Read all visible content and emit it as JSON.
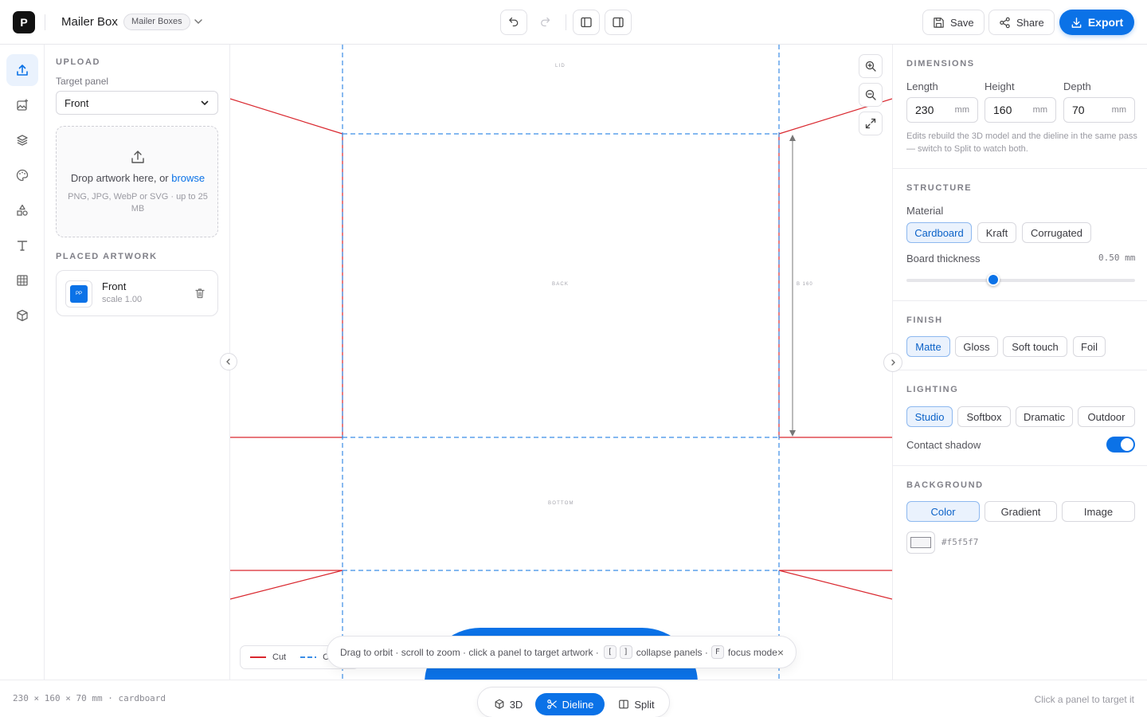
{
  "header": {
    "logo_letter": "P",
    "project_title": "Mailer Box",
    "category_badge": "Mailer Boxes",
    "save_label": "Save",
    "share_label": "Share",
    "export_label": "Export"
  },
  "rail": {
    "items": [
      "upload-icon",
      "image-plus-icon",
      "layers-icon",
      "palette-icon",
      "shapes-icon",
      "text-icon",
      "grid-icon",
      "box-icon"
    ],
    "active": "upload-icon"
  },
  "upload": {
    "section_title": "UPLOAD",
    "target_label": "Target panel",
    "target_value": "Front",
    "drop_text": "Drop artwork here, or ",
    "browse_label": "browse",
    "drop_subtext": "PNG, JPG, WebP or SVG · up to 25 MB"
  },
  "placed": {
    "section_title": "PLACED ARTWORK",
    "items": [
      {
        "name": "Front",
        "scale": "scale 1.00"
      }
    ]
  },
  "canvas": {
    "panels": {
      "lid": "LID",
      "back": "BACK",
      "bottom": "BOTTOM"
    },
    "dimension_label": "B 160",
    "legend": {
      "cut": "Cut",
      "crease": "C"
    },
    "hint": {
      "text1": "Drag to orbit · scroll to zoom · click a panel to target artwork ·",
      "key1": "[",
      "key2": "]",
      "text2": "collapse panels ·",
      "key3": "F",
      "text3": "focus mode",
      "close": "×"
    },
    "colors": {
      "cut": "#d9272e",
      "crease": "#3b8de6",
      "accent": "#0b72e7"
    }
  },
  "dimensions": {
    "section_title": "DIMENSIONS",
    "length_label": "Length",
    "length": "230",
    "height_label": "Height",
    "height": "160",
    "depth_label": "Depth",
    "depth": "70",
    "unit": "mm",
    "help": "Edits rebuild the 3D model and the dieline in the same pass — switch to Split to watch both."
  },
  "structure": {
    "section_title": "STRUCTURE",
    "material_label": "Material",
    "materials": [
      "Cardboard",
      "Kraft",
      "Corrugated"
    ],
    "selected_material": "Cardboard",
    "thickness_label": "Board thickness",
    "thickness_value": "0.50 mm",
    "thickness_fraction": 0.38
  },
  "finish": {
    "section_title": "FINISH",
    "options": [
      "Matte",
      "Gloss",
      "Soft touch",
      "Foil"
    ],
    "selected": "Matte"
  },
  "lighting": {
    "section_title": "LIGHTING",
    "options": [
      "Studio",
      "Softbox",
      "Dramatic",
      "Outdoor"
    ],
    "selected": "Studio",
    "shadow_label": "Contact shadow",
    "shadow_on": true
  },
  "background": {
    "section_title": "BACKGROUND",
    "options": [
      "Color",
      "Gradient",
      "Image"
    ],
    "selected": "Color",
    "color_hex": "#f5f5f7"
  },
  "status": {
    "summary": "230 × 160 × 70 mm · cardboard",
    "hint_right": "Click a panel to target it",
    "modes": [
      "3D",
      "Dieline",
      "Split"
    ],
    "selected_mode": "Dieline"
  }
}
